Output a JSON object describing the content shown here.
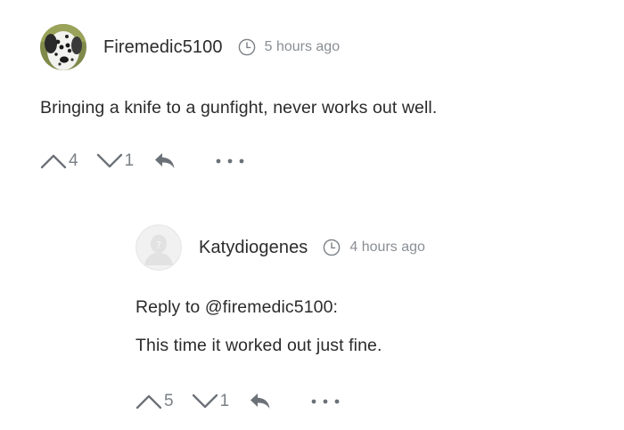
{
  "comments": [
    {
      "username": "Firemedic5100",
      "time": "5 hours ago",
      "text": "Bringing a knife to a gunfight, never works out well.",
      "upvotes": "4",
      "downvotes": "1"
    }
  ],
  "reply": {
    "username": "Katydiogenes",
    "time": "4 hours ago",
    "reply_to": "Reply to @firemedic5100:",
    "text": "This time it worked out just fine.",
    "upvotes": "5",
    "downvotes": "1"
  },
  "icons": {
    "clock": "clock-icon",
    "upvote": "chevron-up-icon",
    "downvote": "chevron-down-icon",
    "reply": "reply-arrow-icon",
    "more": "more-dots-icon"
  },
  "colors": {
    "text": "#2b2b2b",
    "muted": "#8a8f94",
    "icon": "#6b7177"
  }
}
